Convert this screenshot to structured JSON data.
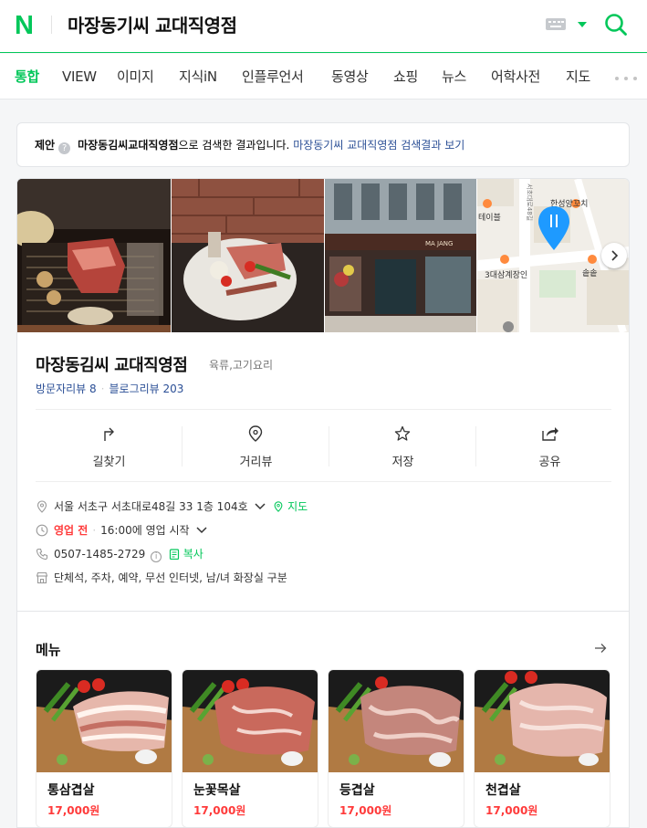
{
  "header": {
    "logo": "N",
    "query": "마장동기씨 교대직영점"
  },
  "tabs": [
    "통합",
    "VIEW",
    "이미지",
    "지식iN",
    "인플루언서",
    "동영상",
    "쇼핑",
    "뉴스",
    "어학사전",
    "지도"
  ],
  "suggestion": {
    "label": "제안",
    "keyword": "마장동김씨교대직영점",
    "middle": "으로 검색한 결과입니다.",
    "link": "마장동기씨 교대직영점 검색결과 보기"
  },
  "map": {
    "labels": [
      "한성양꼬치",
      "테이블",
      "서초대로48길",
      "3대삼계장인",
      "솥솥"
    ]
  },
  "place": {
    "name": "마장동김씨 교대직영점",
    "category": "육류,고기요리",
    "visitor_review": "방문자리뷰 8",
    "blog_review": "블로그리뷰 203"
  },
  "actions": [
    "길찾기",
    "거리뷰",
    "저장",
    "공유"
  ],
  "info": {
    "address": "서울 서초구 서초대로48길 33 1층 104호",
    "map_link": "지도",
    "status": "영업 전",
    "hours": "16:00에 영업 시작",
    "phone": "0507-1485-2729",
    "copy": "복사",
    "amenities": "단체석, 주차, 예약, 무선 인터넷, 남/녀 화장실 구분"
  },
  "menu": {
    "title": "메뉴",
    "items": [
      {
        "name": "통삼겹살",
        "price": "17,000원"
      },
      {
        "name": "눈꽃목살",
        "price": "17,000원"
      },
      {
        "name": "등겹살",
        "price": "17,000원"
      },
      {
        "name": "천겹살",
        "price": "17,000원"
      }
    ]
  },
  "colors": {
    "brand": "#03c75a",
    "link": "#2b4f96",
    "price": "#ff3b3b"
  }
}
